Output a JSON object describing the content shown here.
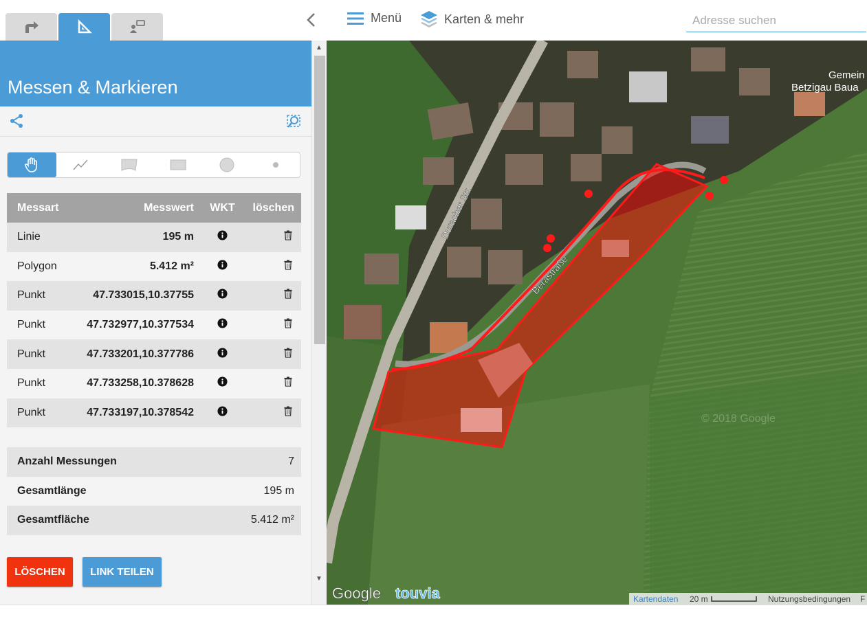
{
  "tabs": [
    {
      "icon": "route-arrow-icon"
    },
    {
      "icon": "ruler-triangle-icon"
    },
    {
      "icon": "map-pin-note-icon"
    }
  ],
  "panel": {
    "title": "Messen & Markieren",
    "modes": [
      "hand-pan-icon",
      "line-icon",
      "flag-polygon-icon",
      "rectangle-icon",
      "circle-icon",
      "point-icon"
    ],
    "table": {
      "headers": [
        "Messart",
        "Messwert",
        "WKT",
        "löschen"
      ],
      "rows": [
        {
          "type": "Linie",
          "value": "195 m"
        },
        {
          "type": "Polygon",
          "value": "5.412 m²"
        },
        {
          "type": "Punkt",
          "value": "47.733015,10.37755"
        },
        {
          "type": "Punkt",
          "value": "47.732977,10.377534"
        },
        {
          "type": "Punkt",
          "value": "47.733201,10.377786"
        },
        {
          "type": "Punkt",
          "value": "47.733258,10.378628"
        },
        {
          "type": "Punkt",
          "value": "47.733197,10.378542"
        }
      ]
    },
    "summary": [
      {
        "label": "Anzahl Messungen",
        "value": "7"
      },
      {
        "label": "Gesamtlänge",
        "value": "195 m"
      },
      {
        "label": "Gesamtfläche",
        "value": "5.412 m²"
      }
    ],
    "buttons": {
      "delete": "LÖSCHEN",
      "share": "LINK TEILEN"
    }
  },
  "topbar": {
    "menu_label": "Menü",
    "maps_label": "Karten & mehr",
    "search_placeholder": "Adresse suchen"
  },
  "map": {
    "labels": {
      "street1": "Duracher Str.",
      "street2": "Berastraße",
      "place": "Gemein",
      "place2": "Betzigau Baua",
      "watermark": "© 2018 Google"
    },
    "google": "Google",
    "touvia": "touvia",
    "attribution": {
      "kartendaten": "Kartendaten",
      "scale": "20 m",
      "terms": "Nutzungsbedingungen",
      "trailing": "F"
    },
    "colors": {
      "measure": "#ff0000",
      "accent": "#4a9bd6"
    }
  }
}
